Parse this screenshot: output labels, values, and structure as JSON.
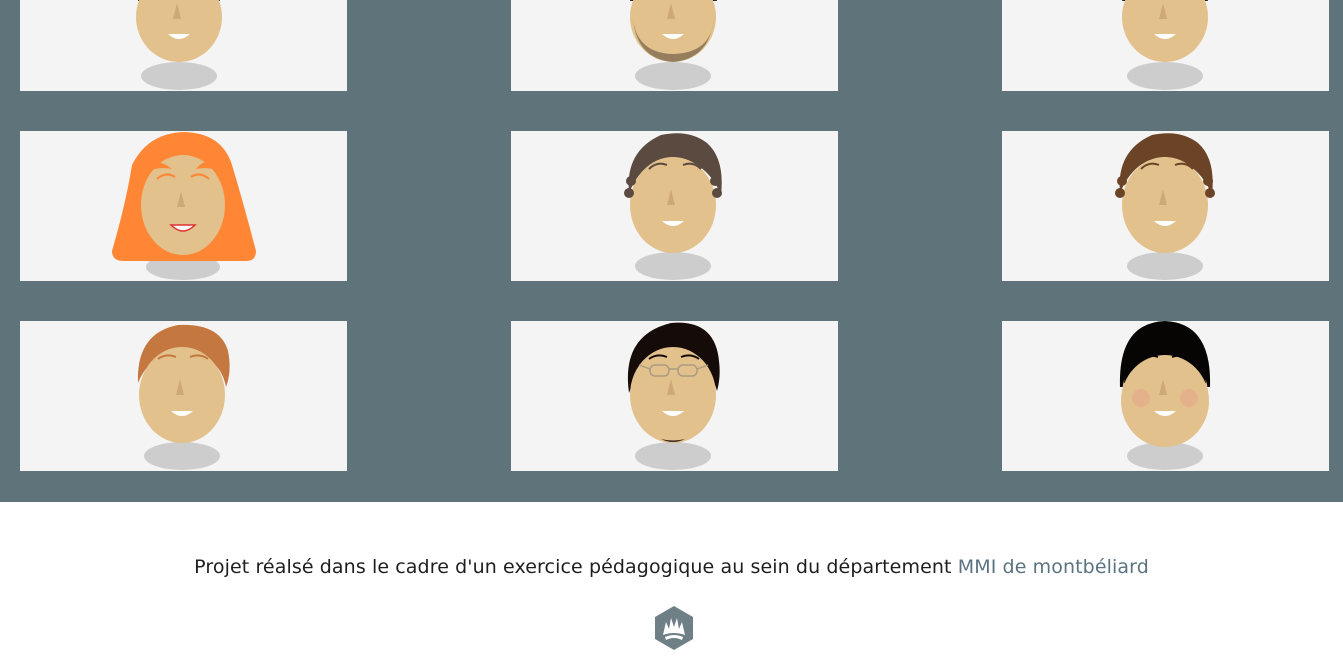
{
  "footer": {
    "text": "Projet réalsé dans le cadre d'un exercice pédagogique au sein du département",
    "link_label": "MMI de montbéliard",
    "logo_icon": "mmi-hexagon-logo-icon"
  },
  "colors": {
    "grid_background": "#5f737b",
    "card_background": "#f4f4f4",
    "skin": "#e2c18c",
    "shadow": "#cdcdcd",
    "link": "#5b7380"
  },
  "avatars": [
    {
      "name": "avatar-1",
      "hair": "dark-top"
    },
    {
      "name": "avatar-2",
      "hair": "dark-beard"
    },
    {
      "name": "avatar-3",
      "hair": "dark-top"
    },
    {
      "name": "avatar-4",
      "hair": "orange-long"
    },
    {
      "name": "avatar-5",
      "hair": "brown-curly"
    },
    {
      "name": "avatar-6",
      "hair": "brown-curly"
    },
    {
      "name": "avatar-7",
      "hair": "ginger-short"
    },
    {
      "name": "avatar-8",
      "hair": "black-glasses"
    },
    {
      "name": "avatar-9",
      "hair": "black-bowl"
    }
  ]
}
